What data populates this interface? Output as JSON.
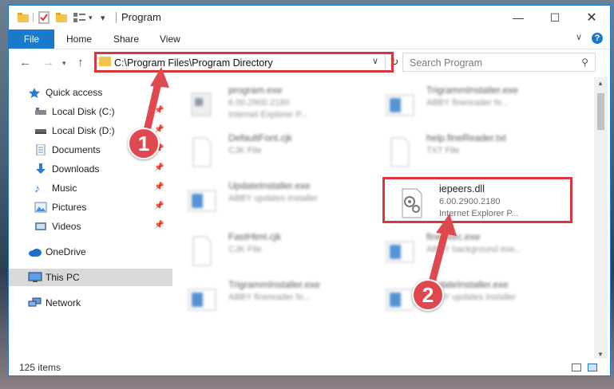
{
  "window": {
    "title": "Program"
  },
  "ribbon": {
    "file": "File",
    "tabs": [
      "Home",
      "Share",
      "View"
    ],
    "help": "?"
  },
  "address": {
    "path": "C:\\Program Files\\Program Directory"
  },
  "search": {
    "placeholder": "Search Program"
  },
  "sidebar": {
    "items": [
      {
        "label": "Quick access",
        "icon": "star-icon"
      },
      {
        "label": "Local Disk (C:)",
        "icon": "drive-icon",
        "pinned": true
      },
      {
        "label": "Local Disk (D:)",
        "icon": "drive-icon",
        "pinned": true
      },
      {
        "label": "Documents",
        "icon": "documents-icon",
        "pinned": true
      },
      {
        "label": "Downloads",
        "icon": "downloads-icon",
        "pinned": true
      },
      {
        "label": "Music",
        "icon": "music-icon",
        "pinned": true
      },
      {
        "label": "Pictures",
        "icon": "pictures-icon",
        "pinned": true
      },
      {
        "label": "Videos",
        "icon": "videos-icon",
        "pinned": true
      },
      {
        "label": "OneDrive",
        "icon": "onedrive-icon"
      },
      {
        "label": "This PC",
        "icon": "pc-icon",
        "selected": true
      },
      {
        "label": "Network",
        "icon": "network-icon"
      }
    ]
  },
  "files": [
    {
      "name": "program.exe",
      "line2": "6.00.2900.2180",
      "line3": "Internet Explorer P...",
      "icon": "exe-icon"
    },
    {
      "name": "TrigrammInstaller.exe",
      "line2": "ABBY finereader fo...",
      "line3": "",
      "icon": "installer-icon"
    },
    {
      "name": "DefaultFont.cjk",
      "line2": "CJK File",
      "line3": "",
      "icon": "blank-file-icon"
    },
    {
      "name": "help.fineReader.txt",
      "line2": "TXT File",
      "line3": "",
      "icon": "text-file-icon"
    },
    {
      "name": "UpdateInstaller.exe",
      "line2": "ABBY updates installer",
      "line3": "",
      "icon": "installer-icon"
    },
    {
      "name": "iepeers.dll",
      "line2": "6.00.2900.2180",
      "line3": "Internet Explorer P...",
      "icon": "dll-gear-icon"
    },
    {
      "name": "FastHtml.cjk",
      "line2": "CJK File",
      "line3": "",
      "icon": "blank-file-icon"
    },
    {
      "name": "fineexec.exe",
      "line2": "ABBY background exe...",
      "line3": "",
      "icon": "installer-icon"
    },
    {
      "name": "TrigrammInstaller.exe",
      "line2": "ABBY finereader fo...",
      "line3": "",
      "icon": "installer-icon"
    },
    {
      "name": "UpdateInstaller.exe",
      "line2": "ABBY updates installer",
      "line3": "",
      "icon": "installer-icon"
    }
  ],
  "status": {
    "count": "125 items"
  },
  "annotations": {
    "step1": "1",
    "step2": "2"
  },
  "colors": {
    "accent": "#1979ca",
    "highlight": "#d9363e",
    "marker": "#e0484f",
    "folder": "#f3c44c"
  }
}
